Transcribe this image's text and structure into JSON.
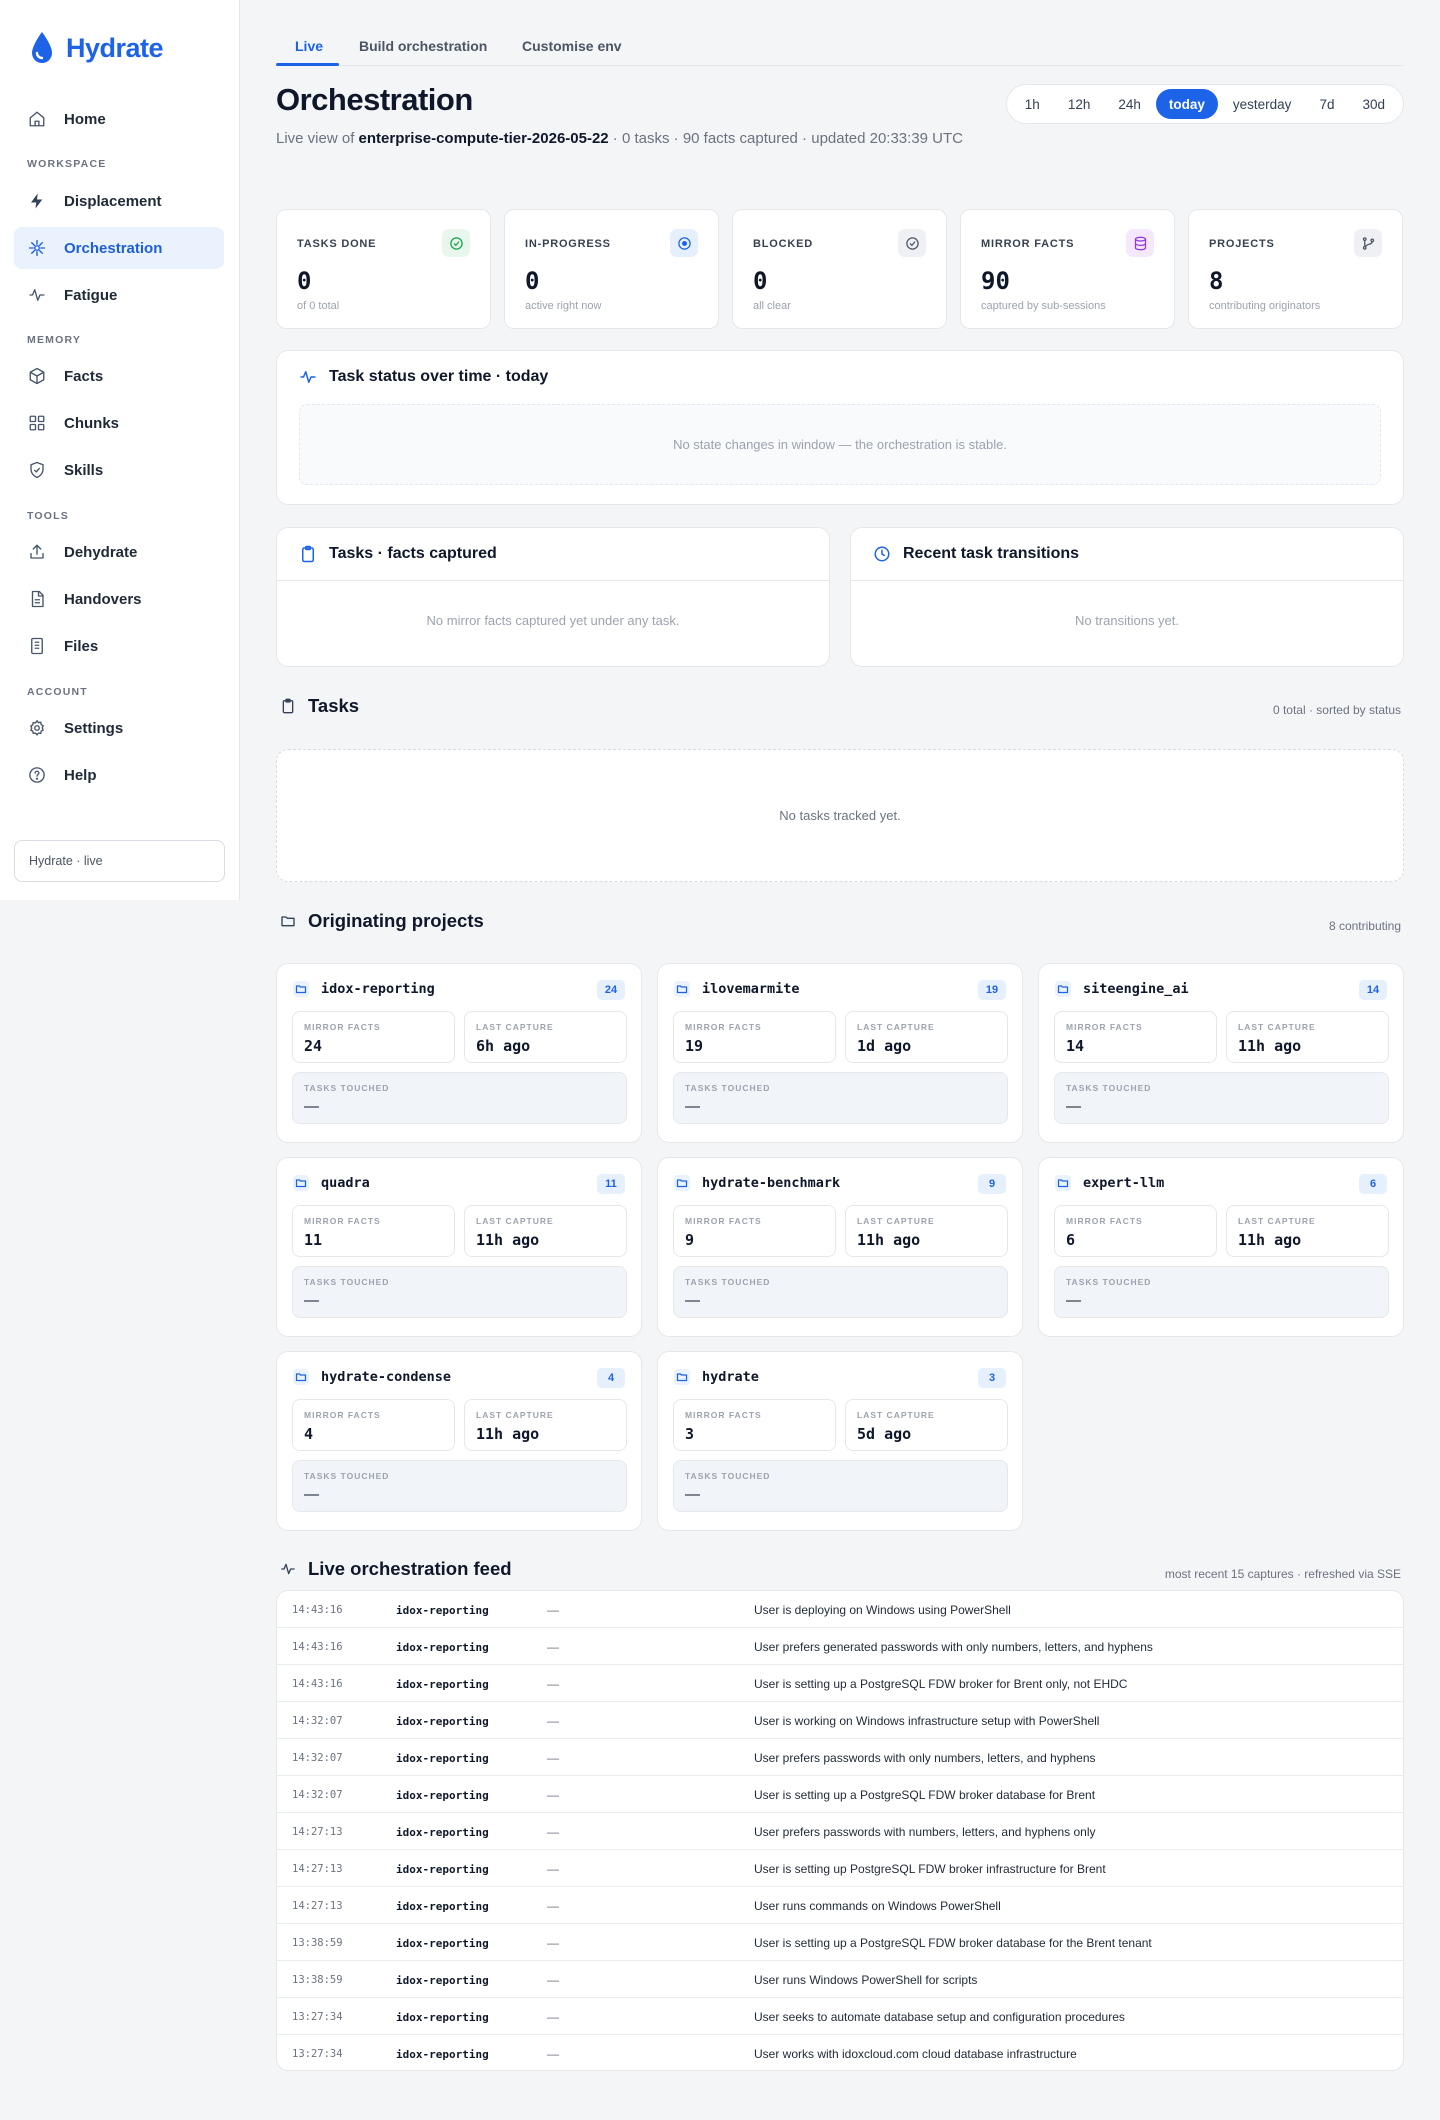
{
  "sidebar": {
    "brand": "Hydrate",
    "home": "Home",
    "sections": {
      "workspace": "WORKSPACE",
      "memory": "MEMORY",
      "tools": "TOOLS",
      "account": "ACCOUNT"
    },
    "items": {
      "displacement": "Displacement",
      "orchestration": "Orchestration",
      "fatigue": "Fatigue",
      "facts": "Facts",
      "chunks": "Chunks",
      "skills": "Skills",
      "dehydrate": "Dehydrate",
      "handovers": "Handovers",
      "files": "Files",
      "settings": "Settings",
      "help": "Help"
    },
    "status": "Hydrate · live"
  },
  "tabs": {
    "live": "Live",
    "build": "Build orchestration",
    "customise": "Customise env"
  },
  "header": {
    "title": "Orchestration",
    "subtitle_prefix": "Live view of ",
    "orchestration_id": "enterprise-compute-tier-2026-05-22",
    "subtitle_suffix": " · 0 tasks · 90 facts captured · updated 20:33:39 UTC"
  },
  "ranges": [
    "1h",
    "12h",
    "24h",
    "today",
    "yesterday",
    "7d",
    "30d"
  ],
  "active_range": "today",
  "stats": [
    {
      "label": "TASKS DONE",
      "value": "0",
      "sub": "of 0 total",
      "icon": "check-circle-icon",
      "color": "#16a34a",
      "bg": "#e8f7ee"
    },
    {
      "label": "IN-PROGRESS",
      "value": "0",
      "sub": "active right now",
      "icon": "target-icon",
      "color": "#1d63e8",
      "bg": "#e6effc"
    },
    {
      "label": "BLOCKED",
      "value": "0",
      "sub": "all clear",
      "icon": "check-circle-icon",
      "color": "#4b5563",
      "bg": "#eef0f3"
    },
    {
      "label": "MIRROR FACTS",
      "value": "90",
      "sub": "captured by sub-sessions",
      "icon": "database-icon",
      "color": "#9333ea",
      "bg": "#f3e8fd"
    },
    {
      "label": "PROJECTS",
      "value": "8",
      "sub": "contributing originators",
      "icon": "git-branch-icon",
      "color": "#4b5563",
      "bg": "#eef0f3"
    }
  ],
  "status_card": {
    "title": "Task status over time · today",
    "empty": "No state changes in window — the orchestration is stable."
  },
  "facts_card": {
    "title": "Tasks · facts captured",
    "empty": "No mirror facts captured yet under any task."
  },
  "transitions_card": {
    "title": "Recent task transitions",
    "empty": "No transitions yet."
  },
  "tasks": {
    "title": "Tasks",
    "meta": "0 total · sorted by status",
    "empty": "No tasks tracked yet."
  },
  "projects": {
    "title": "Originating projects",
    "meta": "8 contributing",
    "labels": {
      "mirror": "MIRROR FACTS",
      "last": "LAST CAPTURE",
      "touched": "TASKS TOUCHED"
    },
    "items": [
      {
        "name": "idox-reporting",
        "count": "24",
        "mirror": "24",
        "last": "6h ago",
        "touched": "—"
      },
      {
        "name": "ilovemarmite",
        "count": "19",
        "mirror": "19",
        "last": "1d ago",
        "touched": "—"
      },
      {
        "name": "siteengine_ai",
        "count": "14",
        "mirror": "14",
        "last": "11h ago",
        "touched": "—"
      },
      {
        "name": "quadra",
        "count": "11",
        "mirror": "11",
        "last": "11h ago",
        "touched": "—"
      },
      {
        "name": "hydrate-benchmark",
        "count": "9",
        "mirror": "9",
        "last": "11h ago",
        "touched": "—"
      },
      {
        "name": "expert-llm",
        "count": "6",
        "mirror": "6",
        "last": "11h ago",
        "touched": "—"
      },
      {
        "name": "hydrate-condense",
        "count": "4",
        "mirror": "4",
        "last": "11h ago",
        "touched": "—"
      },
      {
        "name": "hydrate",
        "count": "3",
        "mirror": "3",
        "last": "5d ago",
        "touched": "—"
      }
    ]
  },
  "feed": {
    "title": "Live orchestration feed",
    "meta": "most recent 15 captures · refreshed via SSE",
    "rows": [
      {
        "time": "14:43:16",
        "project": "idox-reporting",
        "task": "—",
        "text": "User is deploying on Windows using PowerShell"
      },
      {
        "time": "14:43:16",
        "project": "idox-reporting",
        "task": "—",
        "text": "User prefers generated passwords with only numbers, letters, and hyphens"
      },
      {
        "time": "14:43:16",
        "project": "idox-reporting",
        "task": "—",
        "text": "User is setting up a PostgreSQL FDW broker for Brent only, not EHDC"
      },
      {
        "time": "14:32:07",
        "project": "idox-reporting",
        "task": "—",
        "text": "User is working on Windows infrastructure setup with PowerShell"
      },
      {
        "time": "14:32:07",
        "project": "idox-reporting",
        "task": "—",
        "text": "User prefers passwords with only numbers, letters, and hyphens"
      },
      {
        "time": "14:32:07",
        "project": "idox-reporting",
        "task": "—",
        "text": "User is setting up a PostgreSQL FDW broker database for Brent"
      },
      {
        "time": "14:27:13",
        "project": "idox-reporting",
        "task": "—",
        "text": "User prefers passwords with numbers, letters, and hyphens only"
      },
      {
        "time": "14:27:13",
        "project": "idox-reporting",
        "task": "—",
        "text": "User is setting up PostgreSQL FDW broker infrastructure for Brent"
      },
      {
        "time": "14:27:13",
        "project": "idox-reporting",
        "task": "—",
        "text": "User runs commands on Windows PowerShell"
      },
      {
        "time": "13:38:59",
        "project": "idox-reporting",
        "task": "—",
        "text": "User is setting up a PostgreSQL FDW broker database for the Brent tenant"
      },
      {
        "time": "13:38:59",
        "project": "idox-reporting",
        "task": "—",
        "text": "User runs Windows PowerShell for scripts"
      },
      {
        "time": "13:27:34",
        "project": "idox-reporting",
        "task": "—",
        "text": "User seeks to automate database setup and configuration procedures"
      },
      {
        "time": "13:27:34",
        "project": "idox-reporting",
        "task": "—",
        "text": "User works with idoxcloud.com cloud database infrastructure"
      }
    ]
  },
  "colors": {
    "accent": "#1d63e8",
    "active_nav_bg": "#eaf2fd"
  }
}
